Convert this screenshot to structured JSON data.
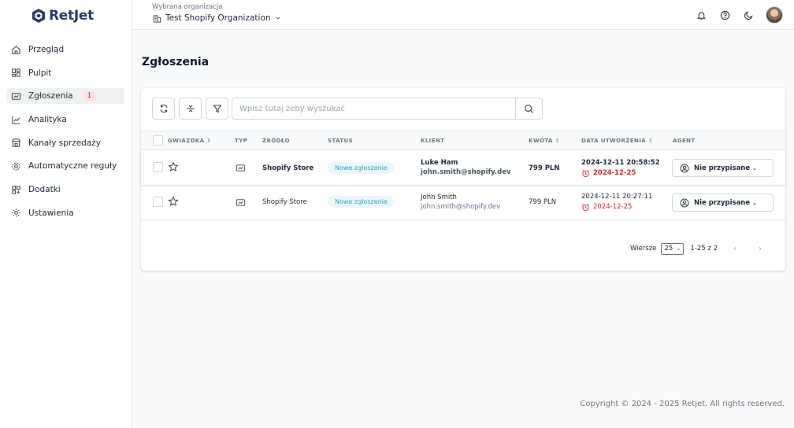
{
  "app": {
    "name": "RetJet"
  },
  "sidebar": {
    "items": [
      {
        "label": "Przegląd",
        "icon": "home-icon"
      },
      {
        "label": "Pulpit",
        "icon": "dashboard-icon"
      },
      {
        "label": "Zgłoszenia",
        "icon": "tickets-icon",
        "active": true,
        "badge": "1"
      },
      {
        "label": "Analityka",
        "icon": "analytics-icon"
      },
      {
        "label": "Kanały sprzedaży",
        "icon": "store-icon"
      },
      {
        "label": "Automatyczne reguły",
        "icon": "automation-gear-icon"
      },
      {
        "label": "Dodatki",
        "icon": "addons-icon"
      },
      {
        "label": "Ustawienia",
        "icon": "settings-icon"
      }
    ]
  },
  "header": {
    "org_label": "Wybrana organizacja",
    "org_name": "Test Shopify Organization"
  },
  "main": {
    "title": "Zgłoszenia",
    "search_placeholder": "Wpisz tutaj żeby wyszukać",
    "columns": {
      "star": "GWIAZDKA",
      "type": "TYP",
      "source": "ŹRÓDŁO",
      "status": "STATUS",
      "client": "KLIENT",
      "amount": "KWOTA",
      "created": "DATA UTWORZENIA",
      "agent": "AGENT"
    },
    "rows": [
      {
        "source": "Shopify Store",
        "status": "Nowe zgłoszenie",
        "client_name": "Luke Ham",
        "client_email": "john.smith@shopify.dev",
        "amount": "799 PLN",
        "created": "2024-12-11 20:58:52",
        "due": "2024-12-25",
        "agent": "Nie przypisane",
        "unread": true
      },
      {
        "source": "Shopify Store",
        "status": "Nowe zgłoszenie",
        "client_name": "John Smith",
        "client_email": "john.smith@shopify.dev",
        "amount": "799 PLN",
        "created": "2024-12-11 20:27:11",
        "due": "2024-12-25",
        "agent": "Nie przypisane",
        "unread": false
      }
    ],
    "pagination": {
      "rows_label": "Wiersze",
      "rows_value": "25",
      "range": "1-25 z 2"
    }
  },
  "footer": {
    "copyright": "Copyright © 2024 - 2025 Retjet. All rights reserved."
  },
  "colors": {
    "accent": "#2b3a67",
    "status_text": "#29a3c7",
    "due_red": "#dc2626",
    "badge_bg": "#fde2e2"
  }
}
